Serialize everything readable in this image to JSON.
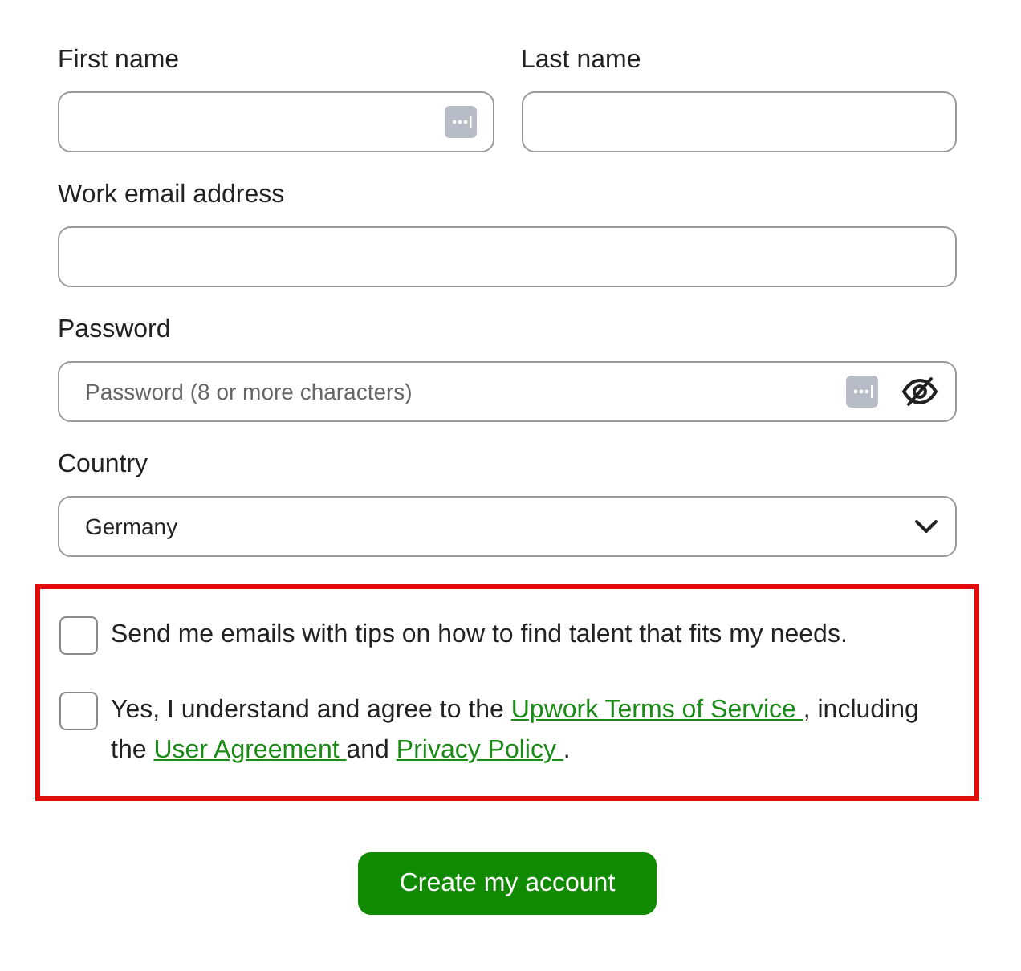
{
  "name_row": [
    {
      "label": "First name",
      "value_icon": true
    },
    {
      "label": "Last name",
      "value_icon": false
    }
  ],
  "email": {
    "label": "Work email address"
  },
  "password": {
    "label": "Password",
    "placeholder": "Password (8 or more characters)",
    "visible": false
  },
  "country": {
    "label": "Country",
    "value": "Germany"
  },
  "consents": {
    "highlighted": true,
    "items": [
      {
        "checked": false,
        "parts": [
          {
            "kind": "text",
            "text": "Send me emails with tips on how to find talent that fits my needs."
          }
        ]
      },
      {
        "checked": false,
        "parts": [
          {
            "kind": "text",
            "text": "Yes, I understand and agree to the "
          },
          {
            "kind": "link",
            "text": "Upwork Terms of Service "
          },
          {
            "kind": "text",
            "text": ", including the "
          },
          {
            "kind": "link",
            "text": "User Agreement "
          },
          {
            "kind": "text",
            "text": "and "
          },
          {
            "kind": "link",
            "text": "Privacy Policy "
          },
          {
            "kind": "text",
            "text": "."
          }
        ]
      }
    ]
  },
  "submit": {
    "label": "Create my account"
  }
}
